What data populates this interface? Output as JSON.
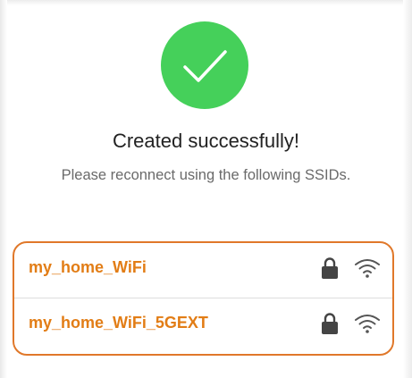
{
  "dialog": {
    "title": "Created successfully!",
    "subtitle": "Please reconnect using the following SSIDs.",
    "success_icon": "checkmark-circle-icon",
    "accent_color": "#e0782a",
    "success_color": "#45d05a"
  },
  "ssids": [
    {
      "name": "my_home_WiFi",
      "lock_icon": "lock-icon",
      "signal_icon": "wifi-icon"
    },
    {
      "name": "my_home_WiFi_5GEXT",
      "lock_icon": "lock-icon",
      "signal_icon": "wifi-icon"
    }
  ]
}
